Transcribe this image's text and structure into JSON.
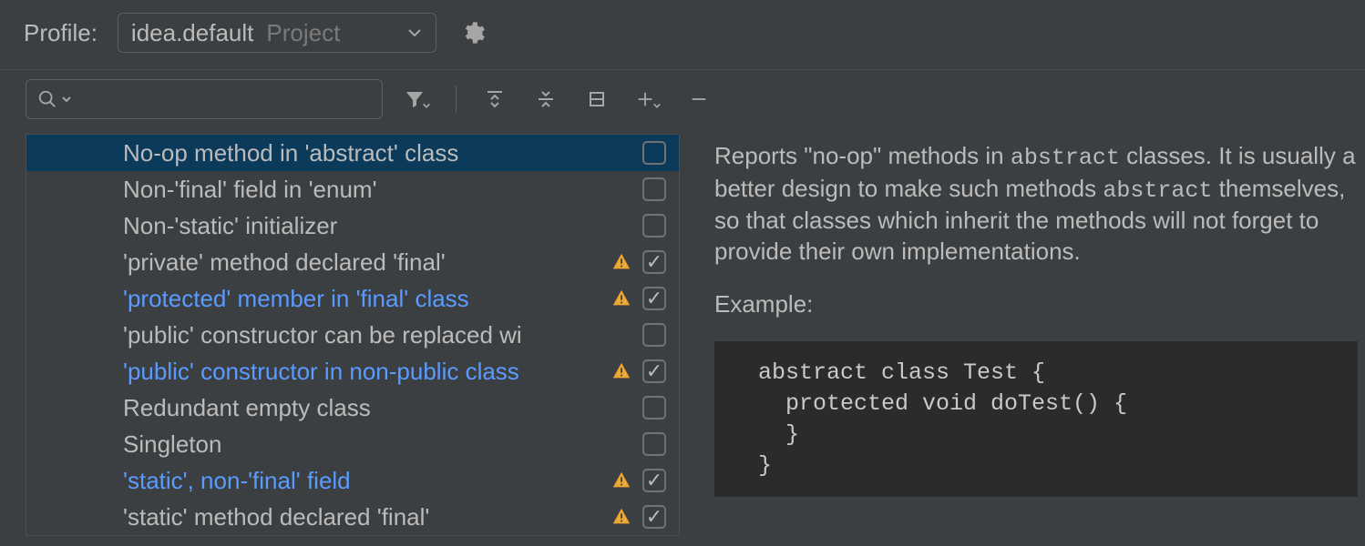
{
  "header": {
    "profile_label": "Profile:",
    "profile_name": "idea.default",
    "profile_scope": "Project"
  },
  "search": {
    "placeholder": ""
  },
  "inspections": [
    {
      "label": "No-op method in 'abstract' class",
      "warn": false,
      "checked": false,
      "selected": true,
      "link": false
    },
    {
      "label": "Non-'final' field in 'enum'",
      "warn": false,
      "checked": false,
      "selected": false,
      "link": false
    },
    {
      "label": "Non-'static' initializer",
      "warn": false,
      "checked": false,
      "selected": false,
      "link": false
    },
    {
      "label": "'private' method declared 'final'",
      "warn": true,
      "checked": true,
      "selected": false,
      "link": false
    },
    {
      "label": "'protected' member in 'final' class",
      "warn": true,
      "checked": true,
      "selected": false,
      "link": true
    },
    {
      "label": "'public' constructor can be replaced wi",
      "warn": false,
      "checked": false,
      "selected": false,
      "link": false
    },
    {
      "label": "'public' constructor in non-public class",
      "warn": true,
      "checked": true,
      "selected": false,
      "link": true
    },
    {
      "label": "Redundant empty class",
      "warn": false,
      "checked": false,
      "selected": false,
      "link": false
    },
    {
      "label": "Singleton",
      "warn": false,
      "checked": false,
      "selected": false,
      "link": false
    },
    {
      "label": "'static', non-'final' field",
      "warn": true,
      "checked": true,
      "selected": false,
      "link": true
    },
    {
      "label": "'static' method declared 'final'",
      "warn": true,
      "checked": true,
      "selected": false,
      "link": false
    }
  ],
  "detail": {
    "desc_pre": "Reports \"no-op\" methods in ",
    "desc_code1": "abstract",
    "desc_mid": " classes. It is usually a better design to make such methods ",
    "desc_code2": "abstract",
    "desc_post": " themselves, so that classes which inherit the methods will not forget to provide their own implementations.",
    "example_label": "Example:",
    "code": "abstract class Test {\n  protected void doTest() {\n  }\n}"
  }
}
